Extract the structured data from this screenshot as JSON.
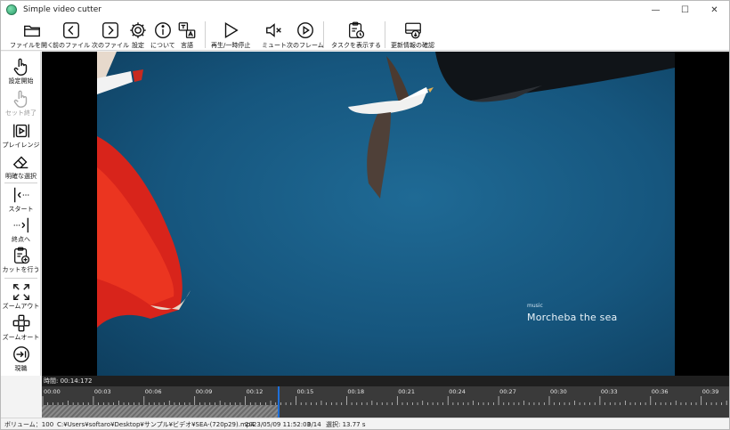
{
  "window": {
    "title": "Simple video cutter",
    "minimize_glyph": "—",
    "maximize_glyph": "☐",
    "close_glyph": "✕"
  },
  "toolbar": {
    "open_file": "ファイルを開く",
    "prev_file": "前のファイル",
    "next_file": "次のファイル",
    "settings": "設定",
    "about": "について",
    "language": "言語",
    "play_pause": "再生/一時停止",
    "mute": "ミュート",
    "next_frame": "次のフレーム",
    "show_tasks": "タスクを表示する",
    "check_updates": "更新情報の確認"
  },
  "sidebar": {
    "set_start": "設定開始",
    "set_end": "セット終了",
    "preview": "プレイレンジ",
    "clear_selection": "明確な選択",
    "go_start": "スタート",
    "go_end": "終点へ",
    "do_cut": "カットを行う",
    "zoom_out": "ズームアウト",
    "zoom_auto": "ズームオート",
    "current": "現職"
  },
  "video": {
    "caption_small": "music",
    "caption_big": "Morcheba  the sea"
  },
  "timeline": {
    "time_label": "時間:  00:14:172",
    "ticks": [
      "00:00",
      "00:03",
      "00:06",
      "00:09",
      "00:12",
      "00:15",
      "00:18",
      "00:21",
      "00:24",
      "00:27",
      "00:30",
      "00:33",
      "00:36",
      "00:39"
    ],
    "selection_fraction": 0.343
  },
  "status": {
    "volume": "ボリューム：100",
    "file_path": "C:¥Users¥softaro¥Desktop¥サンプル¥ビデオ¥SEA-(720p29).mp4",
    "file_date": "2023/05/09 11:52:03",
    "file_index": "0/14",
    "selection": "選択: 13.77 s"
  },
  "colors": {
    "accent": "#1e6fd9",
    "sea": "#16567e"
  }
}
